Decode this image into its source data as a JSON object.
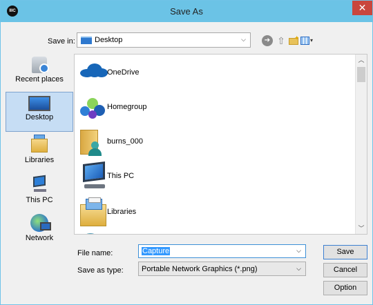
{
  "window": {
    "title": "Save As",
    "app_icon_text": "IIIC",
    "close_label": "✕"
  },
  "toolbar": {
    "save_in_label": "Save in:",
    "save_in_value": "Desktop",
    "icons": [
      "back-icon",
      "up-folder-icon",
      "new-folder-icon",
      "views-menu-icon"
    ]
  },
  "places": [
    {
      "label": "Recent places",
      "icon": "recent-places-icon"
    },
    {
      "label": "Desktop",
      "icon": "desktop-icon",
      "selected": true
    },
    {
      "label": "Libraries",
      "icon": "libraries-icon"
    },
    {
      "label": "This PC",
      "icon": "this-pc-icon"
    },
    {
      "label": "Network",
      "icon": "network-icon"
    }
  ],
  "files": [
    {
      "name": "OneDrive",
      "icon": "onedrive-icon"
    },
    {
      "name": "Homegroup",
      "icon": "homegroup-icon"
    },
    {
      "name": "burns_000",
      "icon": "user-folder-icon"
    },
    {
      "name": "This PC",
      "icon": "this-pc-icon"
    },
    {
      "name": "Libraries",
      "icon": "libraries-icon"
    }
  ],
  "form": {
    "file_name_label": "File name:",
    "file_name_value": "Capture",
    "save_type_label": "Save as type:",
    "save_type_value": "Portable Network Graphics (*.png)"
  },
  "buttons": {
    "save": "Save",
    "cancel": "Cancel",
    "option": "Option"
  },
  "colors": {
    "titlebar": "#6bc3e6",
    "close": "#c9463d",
    "selection": "#3399ff"
  }
}
